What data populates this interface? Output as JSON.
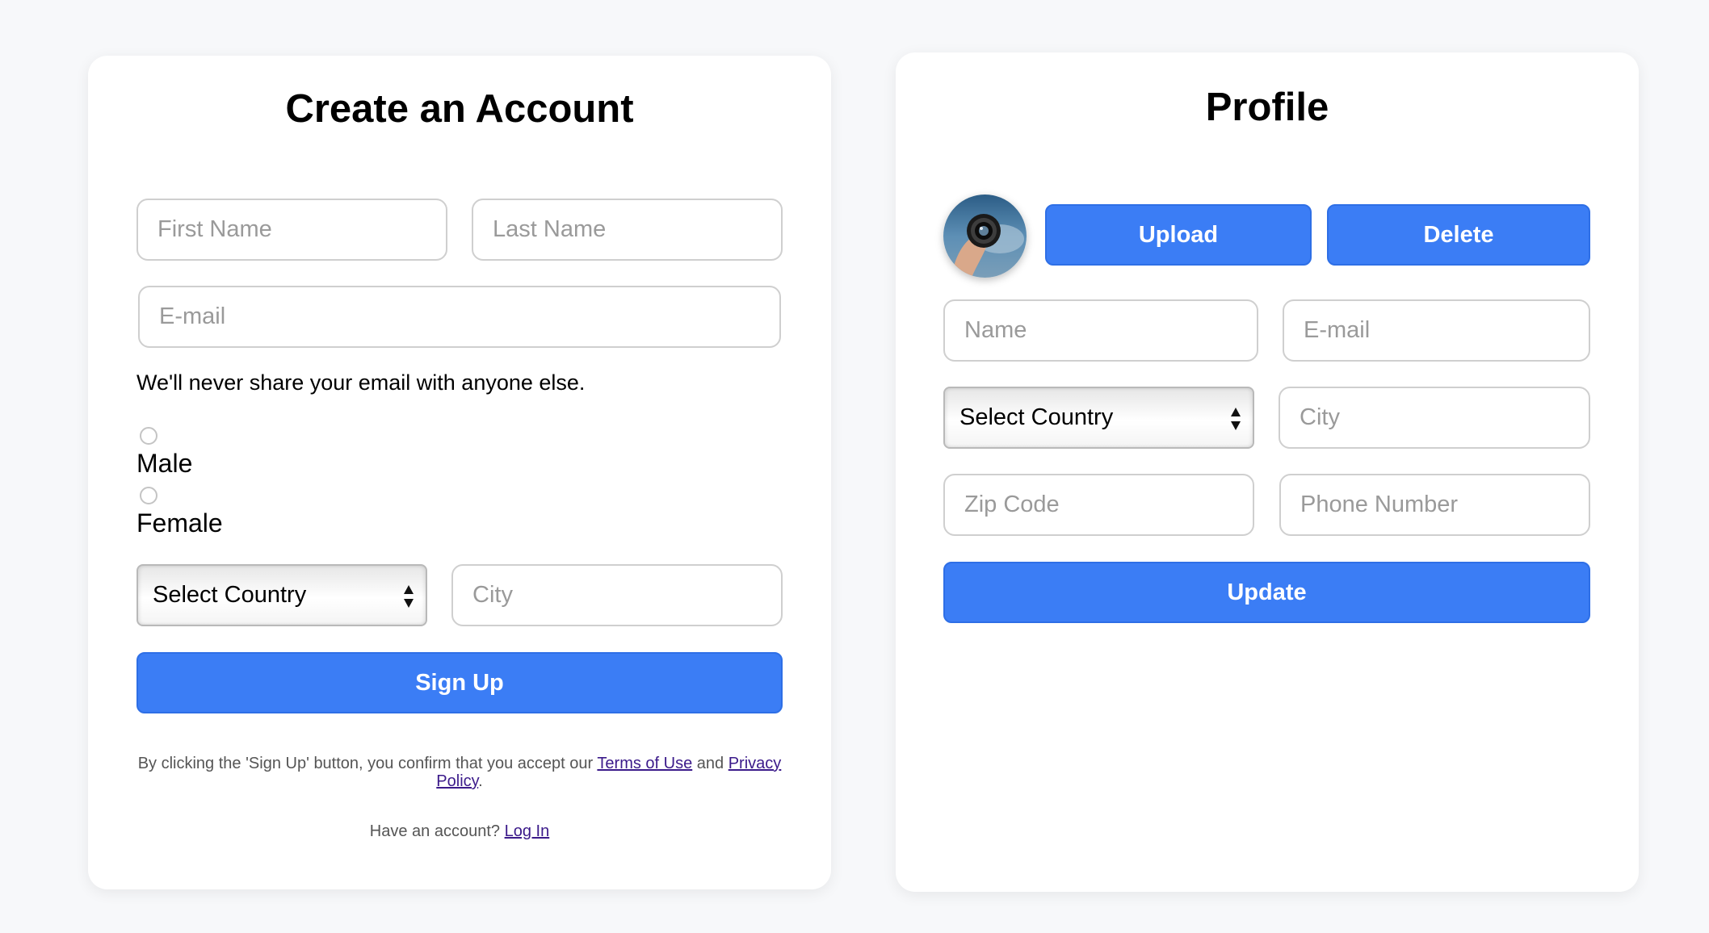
{
  "signup": {
    "title": "Create an Account",
    "first_name_placeholder": "First Name",
    "last_name_placeholder": "Last Name",
    "email_placeholder": "E-mail",
    "email_help": "We'll never share your email with anyone else.",
    "gender_options": [
      "Male",
      "Female"
    ],
    "country_select": "Select Country",
    "city_placeholder": "City",
    "submit_label": "Sign Up",
    "terms_prefix": "By clicking the 'Sign Up' button, you confirm that you accept our",
    "terms_link": "Terms of Use",
    "terms_and": "and",
    "privacy_link_part1": "Privacy",
    "privacy_link_part2": "Policy",
    "terms_suffix": ".",
    "login_prompt": "Have an account?",
    "login_link": "Log In"
  },
  "profile": {
    "title": "Profile",
    "avatar_icon": "camera-lens-photo-icon",
    "upload_label": "Upload",
    "delete_label": "Delete",
    "name_placeholder": "Name",
    "email_placeholder": "E-mail",
    "country_select": "Select Country",
    "city_placeholder": "City",
    "zip_placeholder": "Zip Code",
    "phone_placeholder": "Phone Number",
    "update_label": "Update"
  },
  "colors": {
    "accent": "#3b7df5",
    "background": "#f7f8fa",
    "link": "#3b1a8a"
  }
}
